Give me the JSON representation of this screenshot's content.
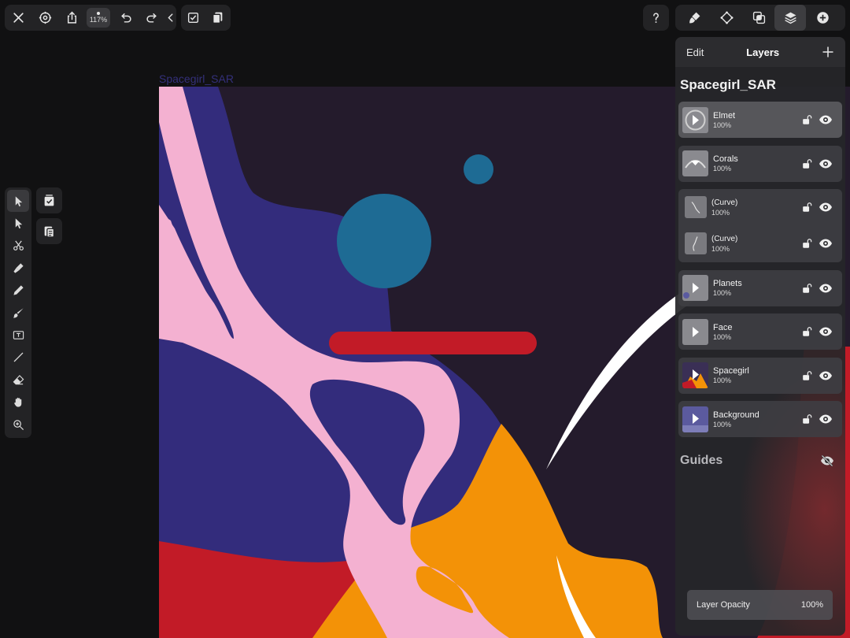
{
  "toolbar": {
    "zoom": "117%"
  },
  "artboard": {
    "title": "Spacegirl_SAR"
  },
  "panel": {
    "edit_label": "Edit",
    "tab_label": "Layers",
    "document_title": "Spacegirl_SAR",
    "layers": [
      {
        "name": "Elmet",
        "opacity": "100%",
        "selected": true
      },
      {
        "name": "Corals",
        "opacity": "100%"
      },
      {
        "name": "(Curve)",
        "opacity": "100%"
      },
      {
        "name": "(Curve)",
        "opacity": "100%"
      },
      {
        "name": "Planets",
        "opacity": "100%"
      },
      {
        "name": "Face",
        "opacity": "100%"
      },
      {
        "name": "Spacegirl",
        "opacity": "100%"
      },
      {
        "name": "Background",
        "opacity": "100%"
      }
    ],
    "guides_label": "Guides",
    "layer_opacity_label": "Layer Opacity",
    "layer_opacity_value": "100%"
  },
  "colors": {
    "artboard_bg": "#241b2c",
    "navy": "#332c7c",
    "pink": "#f4b1d1",
    "blue": "#1e6b94",
    "red": "#c21b27",
    "orange": "#f39207",
    "white": "#ffffff"
  }
}
